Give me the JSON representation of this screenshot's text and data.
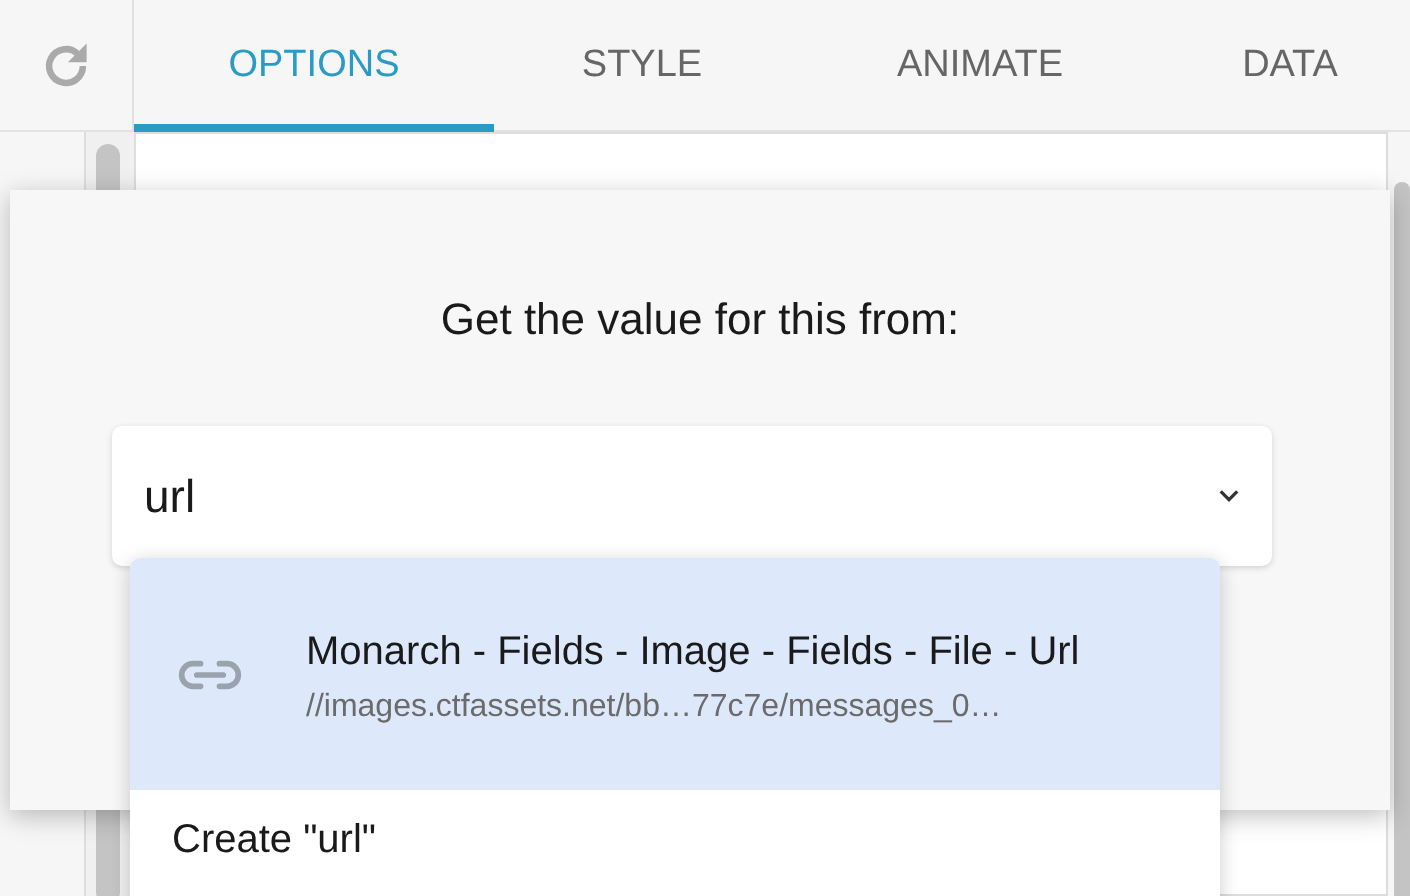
{
  "tabs": [
    {
      "label": "OPTIONS",
      "selected": true
    },
    {
      "label": "STYLE",
      "selected": false
    },
    {
      "label": "ANIMATE",
      "selected": false
    },
    {
      "label": "DATA",
      "selected": false
    }
  ],
  "popover": {
    "title": "Get the value for this from:",
    "field": {
      "value": "url"
    },
    "options": [
      {
        "kind": "source",
        "title": "Monarch - Fields - Image - Fields - File - Url",
        "detail": "//images.ctfassets.net/bb…77c7e/messages_0…",
        "selected": true
      },
      {
        "kind": "create",
        "title": "Create \"url\"",
        "selected": false
      }
    ]
  }
}
